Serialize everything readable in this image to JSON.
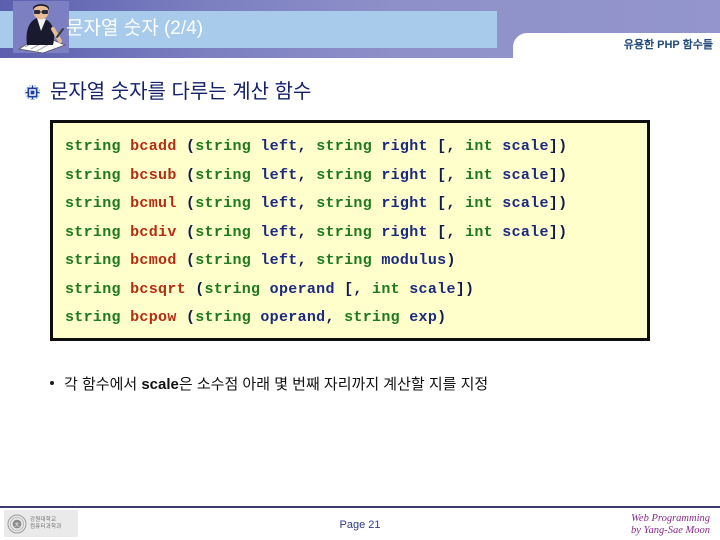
{
  "header": {
    "title": "문자열 숫자 (2/4)",
    "subtitle": "유용한 PHP 함수들",
    "presenter_icon": "presenter-writing-icon"
  },
  "section": {
    "bullet_icon": "ornament-bullet-icon",
    "title": "문자열 숫자를 다루는 계산 함수"
  },
  "code_box": {
    "background_color": "#FFFFCC",
    "border_color": "#0D0D0D",
    "colors": {
      "type": "#1F7A1F",
      "function": "#B32D12",
      "param": "#1B2A80",
      "punct": "#101A4D"
    },
    "lines": [
      {
        "id": "bcadd",
        "tokens": [
          {
            "t": "string",
            "c": "type"
          },
          {
            "t": " ",
            "c": "plain"
          },
          {
            "t": "bcadd",
            "c": "fn"
          },
          {
            "t": " (",
            "c": "punct"
          },
          {
            "t": "string",
            "c": "type"
          },
          {
            "t": " ",
            "c": "plain"
          },
          {
            "t": "left",
            "c": "param"
          },
          {
            "t": ", ",
            "c": "punct"
          },
          {
            "t": "string",
            "c": "type"
          },
          {
            "t": " ",
            "c": "plain"
          },
          {
            "t": "right",
            "c": "param"
          },
          {
            "t": " [, ",
            "c": "punct"
          },
          {
            "t": "int",
            "c": "type"
          },
          {
            "t": " ",
            "c": "plain"
          },
          {
            "t": "scale",
            "c": "param"
          },
          {
            "t": "])",
            "c": "punct"
          }
        ]
      },
      {
        "id": "bcsub",
        "tokens": [
          {
            "t": "string",
            "c": "type"
          },
          {
            "t": " ",
            "c": "plain"
          },
          {
            "t": "bcsub",
            "c": "fn"
          },
          {
            "t": " (",
            "c": "punct"
          },
          {
            "t": "string",
            "c": "type"
          },
          {
            "t": " ",
            "c": "plain"
          },
          {
            "t": "left",
            "c": "param"
          },
          {
            "t": ", ",
            "c": "punct"
          },
          {
            "t": "string",
            "c": "type"
          },
          {
            "t": " ",
            "c": "plain"
          },
          {
            "t": "right",
            "c": "param"
          },
          {
            "t": " [, ",
            "c": "punct"
          },
          {
            "t": "int",
            "c": "type"
          },
          {
            "t": " ",
            "c": "plain"
          },
          {
            "t": "scale",
            "c": "param"
          },
          {
            "t": "])",
            "c": "punct"
          }
        ]
      },
      {
        "id": "bcmul",
        "tokens": [
          {
            "t": "string",
            "c": "type"
          },
          {
            "t": " ",
            "c": "plain"
          },
          {
            "t": "bcmul",
            "c": "fn"
          },
          {
            "t": " (",
            "c": "punct"
          },
          {
            "t": "string",
            "c": "type"
          },
          {
            "t": " ",
            "c": "plain"
          },
          {
            "t": "left",
            "c": "param"
          },
          {
            "t": ", ",
            "c": "punct"
          },
          {
            "t": "string",
            "c": "type"
          },
          {
            "t": " ",
            "c": "plain"
          },
          {
            "t": "right",
            "c": "param"
          },
          {
            "t": " [, ",
            "c": "punct"
          },
          {
            "t": "int",
            "c": "type"
          },
          {
            "t": " ",
            "c": "plain"
          },
          {
            "t": "scale",
            "c": "param"
          },
          {
            "t": "])",
            "c": "punct"
          }
        ]
      },
      {
        "id": "bcdiv",
        "tokens": [
          {
            "t": "string",
            "c": "type"
          },
          {
            "t": " ",
            "c": "plain"
          },
          {
            "t": "bcdiv",
            "c": "fn"
          },
          {
            "t": " (",
            "c": "punct"
          },
          {
            "t": "string",
            "c": "type"
          },
          {
            "t": " ",
            "c": "plain"
          },
          {
            "t": "left",
            "c": "param"
          },
          {
            "t": ", ",
            "c": "punct"
          },
          {
            "t": "string",
            "c": "type"
          },
          {
            "t": " ",
            "c": "plain"
          },
          {
            "t": "right",
            "c": "param"
          },
          {
            "t": " [, ",
            "c": "punct"
          },
          {
            "t": "int",
            "c": "type"
          },
          {
            "t": " ",
            "c": "plain"
          },
          {
            "t": "scale",
            "c": "param"
          },
          {
            "t": "])",
            "c": "punct"
          }
        ]
      },
      {
        "id": "bcmod",
        "tokens": [
          {
            "t": "string",
            "c": "type"
          },
          {
            "t": " ",
            "c": "plain"
          },
          {
            "t": "bcmod",
            "c": "fn"
          },
          {
            "t": " (",
            "c": "punct"
          },
          {
            "t": "string",
            "c": "type"
          },
          {
            "t": " ",
            "c": "plain"
          },
          {
            "t": "left",
            "c": "param"
          },
          {
            "t": ", ",
            "c": "punct"
          },
          {
            "t": "string",
            "c": "type"
          },
          {
            "t": " ",
            "c": "plain"
          },
          {
            "t": "modulus",
            "c": "param"
          },
          {
            "t": ")",
            "c": "punct"
          }
        ]
      },
      {
        "id": "bcsqrt",
        "tokens": [
          {
            "t": "string",
            "c": "type"
          },
          {
            "t": " ",
            "c": "plain"
          },
          {
            "t": "bcsqrt",
            "c": "fn"
          },
          {
            "t": " (",
            "c": "punct"
          },
          {
            "t": "string",
            "c": "type"
          },
          {
            "t": " ",
            "c": "plain"
          },
          {
            "t": "operand",
            "c": "param"
          },
          {
            "t": " [, ",
            "c": "punct"
          },
          {
            "t": "int",
            "c": "type"
          },
          {
            "t": " ",
            "c": "plain"
          },
          {
            "t": "scale",
            "c": "param"
          },
          {
            "t": "])",
            "c": "punct"
          }
        ]
      },
      {
        "id": "bcpow",
        "tokens": [
          {
            "t": "string",
            "c": "type"
          },
          {
            "t": " ",
            "c": "plain"
          },
          {
            "t": "bcpow",
            "c": "fn"
          },
          {
            "t": " (",
            "c": "punct"
          },
          {
            "t": "string",
            "c": "type"
          },
          {
            "t": " ",
            "c": "plain"
          },
          {
            "t": "operand",
            "c": "param"
          },
          {
            "t": ", ",
            "c": "punct"
          },
          {
            "t": "string",
            "c": "type"
          },
          {
            "t": " ",
            "c": "plain"
          },
          {
            "t": "exp",
            "c": "param"
          },
          {
            "t": ")",
            "c": "punct"
          }
        ]
      }
    ]
  },
  "note": {
    "prefix": "각 함수에서 ",
    "emphasis": "scale",
    "suffix": "은 소수점 아래 몇 번째 자리까지 계산할 지를 지정"
  },
  "footer": {
    "logo_icon": "university-emblem-icon",
    "logo_line1": "강원대학교",
    "logo_line2": "컴퓨터과학과",
    "page_label": "Page 21",
    "credit_line1": "Web Programming",
    "credit_line2": "by Yang-Sae Moon"
  }
}
